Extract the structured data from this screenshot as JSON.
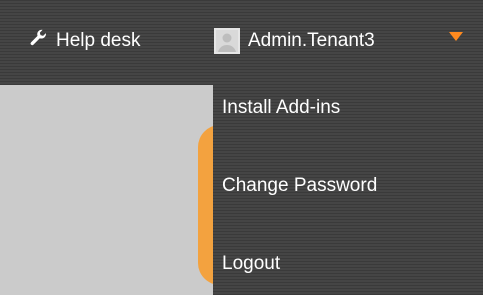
{
  "header": {
    "help_label": "Help desk",
    "user_name": "Admin.Tenant3"
  },
  "user_menu": {
    "items": [
      {
        "label": "Install Add-ins"
      },
      {
        "label": "Change Password"
      },
      {
        "label": "Logout"
      }
    ]
  },
  "icons": {
    "help": "wrench-icon",
    "avatar": "user-avatar-icon",
    "dropdown": "caret-down-icon"
  },
  "colors": {
    "bar_dark": "#3d3d3d",
    "accent_orange": "#ff8a1f",
    "content_gray": "#cbcbcb",
    "text": "#ffffff"
  }
}
